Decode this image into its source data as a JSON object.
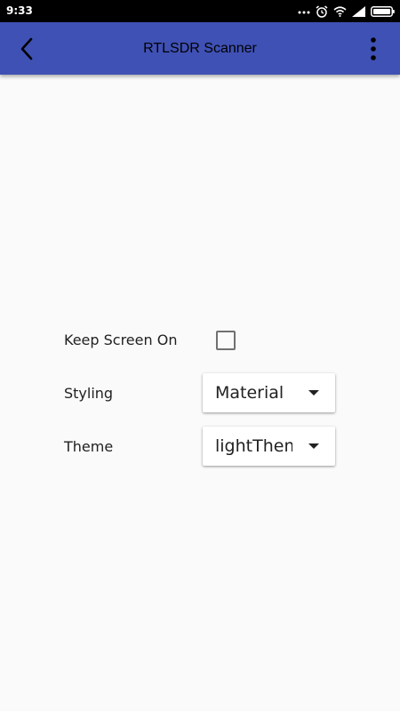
{
  "status_bar": {
    "time": "9:33",
    "icons": [
      "more-dots-icon",
      "alarm-icon",
      "wifi-icon",
      "signal-icon",
      "battery-icon"
    ]
  },
  "app_bar": {
    "title": "RTLSDR Scanner",
    "back_icon": "back-arrow-icon",
    "menu_icon": "overflow-menu-icon",
    "color": "#3f51b5"
  },
  "settings": {
    "keep_screen_on": {
      "label": "Keep Screen On",
      "checked": false
    },
    "styling": {
      "label": "Styling",
      "value": "Material"
    },
    "theme": {
      "label": "Theme",
      "value": "lightTheme"
    }
  }
}
